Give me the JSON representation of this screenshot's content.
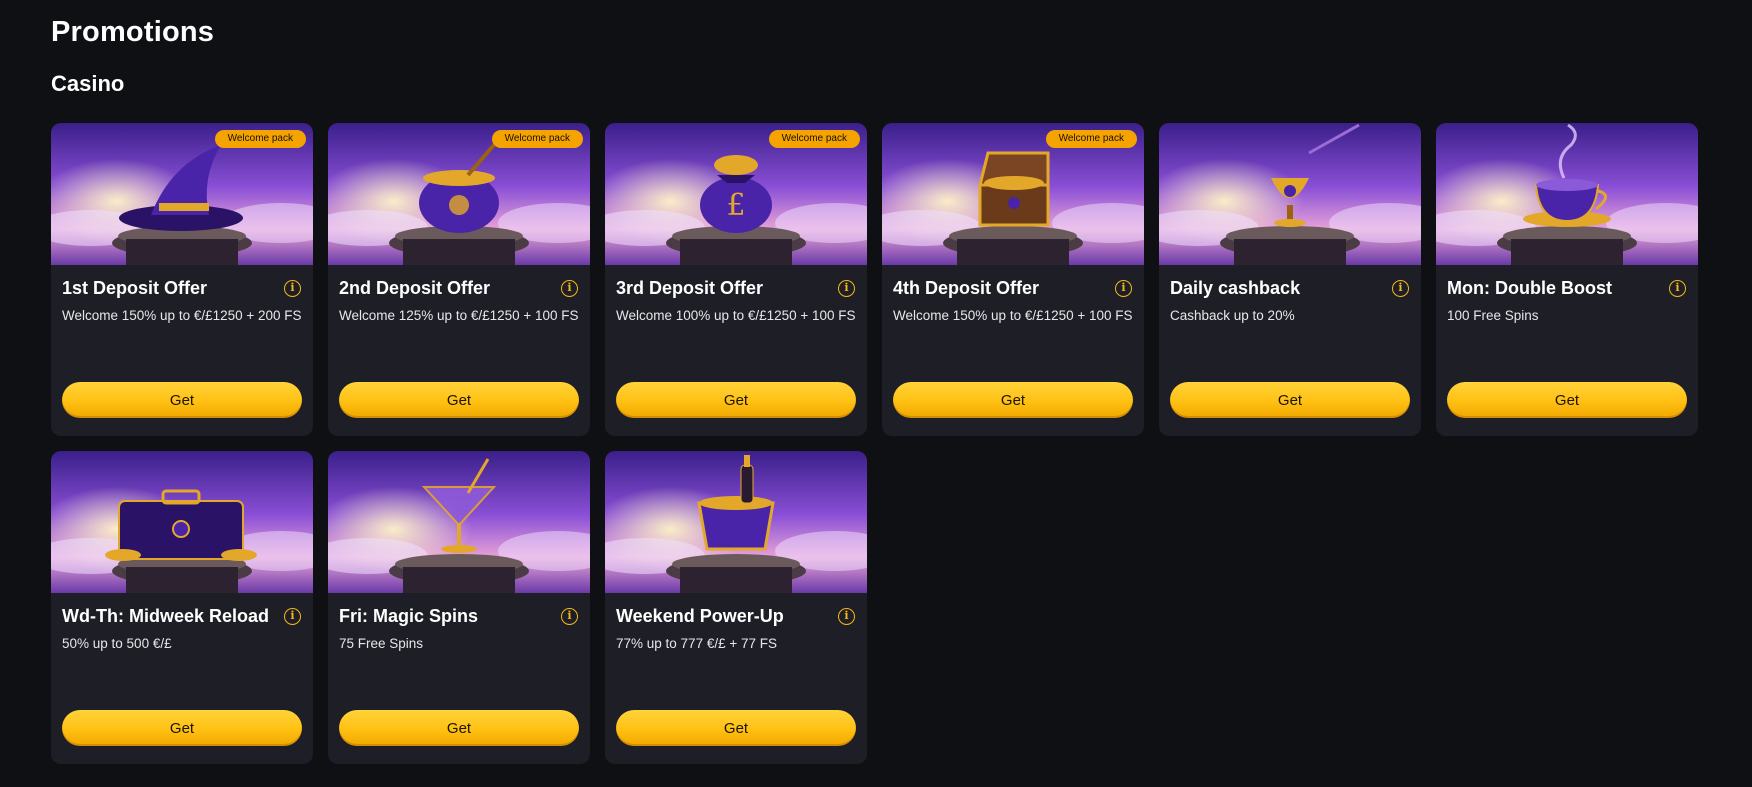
{
  "page": {
    "title": "Promotions",
    "section": "Casino"
  },
  "cards": [
    {
      "title": "1st Deposit Offer",
      "desc": "Welcome 150% up to €/£1250 + 200 FS",
      "badge": "Welcome pack",
      "button": "Get",
      "art": "wizard-hat"
    },
    {
      "title": "2nd Deposit Offer",
      "desc": "Welcome 125% up to €/£1250 + 100 FS",
      "badge": "Welcome pack",
      "button": "Get",
      "art": "cauldron"
    },
    {
      "title": "3rd Deposit Offer",
      "desc": "Welcome 100% up to €/£1250 + 100 FS",
      "badge": "Welcome pack",
      "button": "Get",
      "art": "money-bag"
    },
    {
      "title": "4th Deposit Offer",
      "desc": "Welcome 150% up to €/£1250 + 100 FS",
      "badge": "Welcome pack",
      "button": "Get",
      "art": "treasure-chest"
    },
    {
      "title": "Daily cashback",
      "desc": "Cashback up to 20%",
      "badge": "",
      "button": "Get",
      "art": "goblet"
    },
    {
      "title": "Mon: Double Boost",
      "desc": "100 Free Spins",
      "badge": "",
      "button": "Get",
      "art": "teacup"
    },
    {
      "title": "Wd-Th: Midweek Reload",
      "desc": "50% up to 500 €/£",
      "badge": "",
      "button": "Get",
      "art": "briefcase"
    },
    {
      "title": "Fri: Magic Spins",
      "desc": "75 Free Spins",
      "badge": "",
      "button": "Get",
      "art": "cocktail-glass"
    },
    {
      "title": "Weekend Power-Up",
      "desc": "77% up to 777 €/£ + 77 FS",
      "badge": "",
      "button": "Get",
      "art": "champagne-bucket"
    }
  ]
}
